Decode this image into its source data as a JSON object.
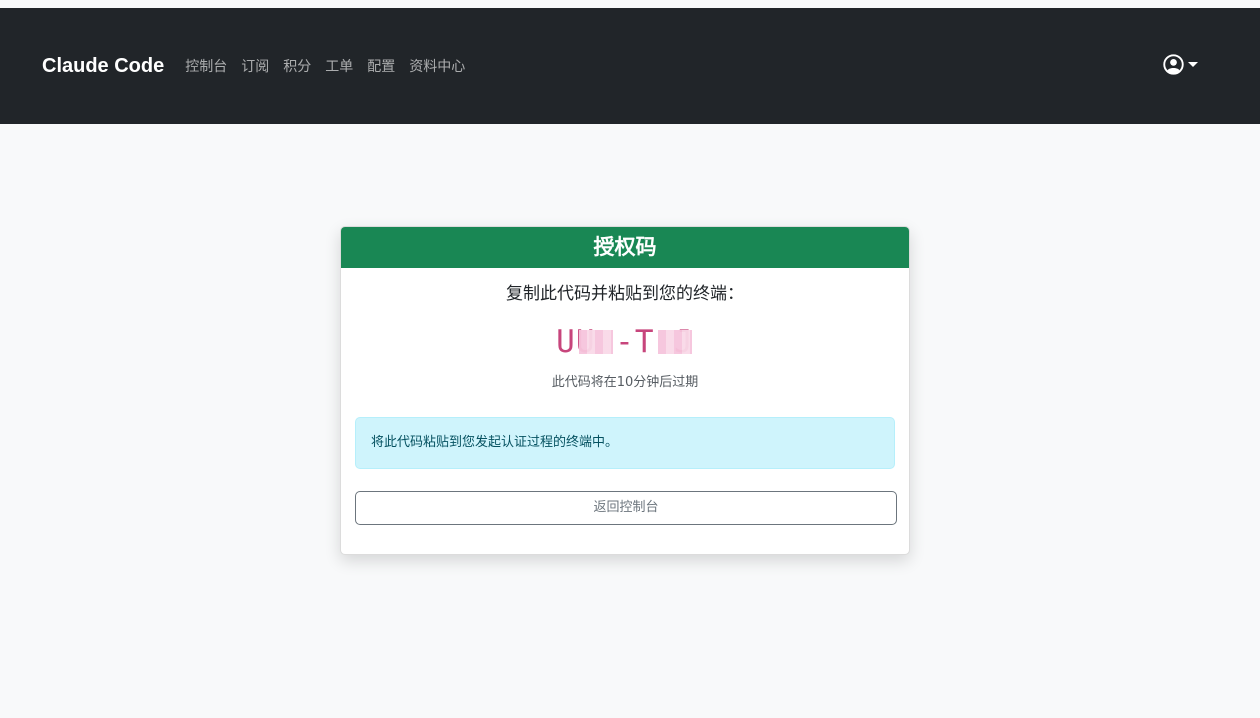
{
  "navbar": {
    "brand": "Claude Code",
    "links": [
      "控制台",
      "订阅",
      "积分",
      "工单",
      "配置",
      "资料中心"
    ],
    "user_icon": "user-circle-icon"
  },
  "card": {
    "header": "授权码",
    "instruction": "复制此代码并粘贴到您的终端：",
    "code": "UU   -T   J",
    "expire_text": "此代码将在10分钟后过期",
    "alert_text": "将此代码粘贴到您发起认证过程的终端中。",
    "back_button": "返回控制台"
  },
  "colors": {
    "navbar_bg": "#212529",
    "header_bg": "#198754",
    "code_color": "#c7457c",
    "alert_bg": "#cff4fc"
  }
}
